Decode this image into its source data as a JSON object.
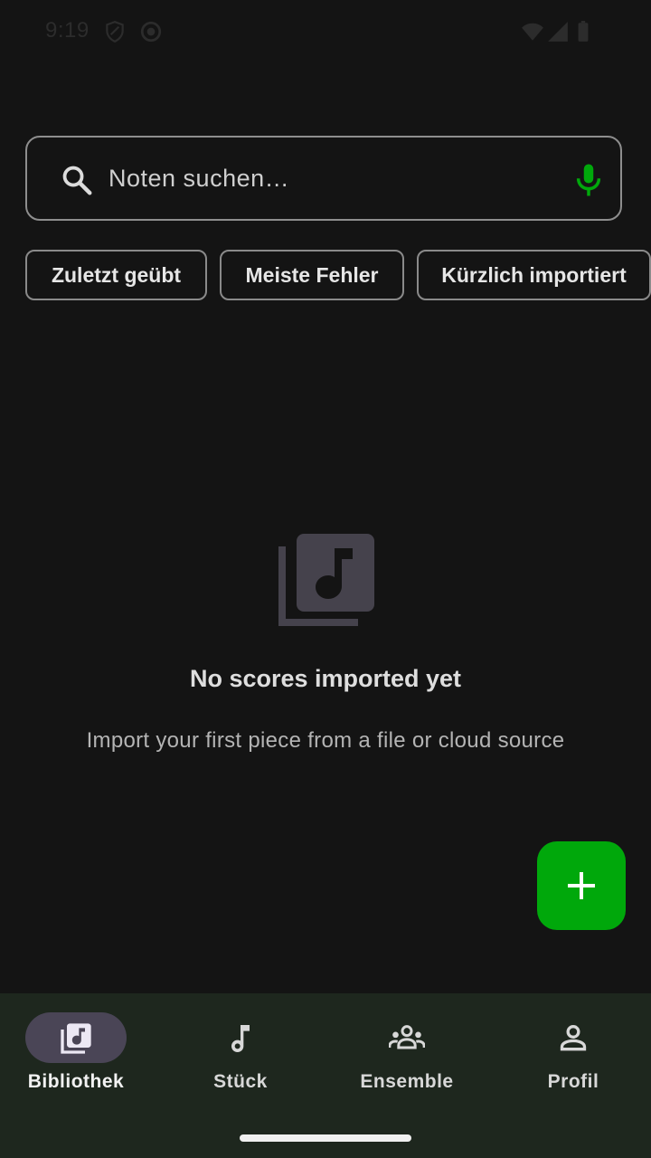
{
  "status_bar": {
    "time": "9:19"
  },
  "search": {
    "placeholder": "Noten suchen…"
  },
  "chips": [
    {
      "label": "Zuletzt geübt"
    },
    {
      "label": "Meiste Fehler"
    },
    {
      "label": "Kürzlich importiert"
    }
  ],
  "empty_state": {
    "title": "No scores imported yet",
    "subtitle": "Import your first piece from a file or cloud source"
  },
  "nav": {
    "items": [
      {
        "label": "Bibliothek",
        "icon": "library-music-icon",
        "active": true
      },
      {
        "label": "Stück",
        "icon": "music-note-icon",
        "active": false
      },
      {
        "label": "Ensemble",
        "icon": "groups-icon",
        "active": false
      },
      {
        "label": "Profil",
        "icon": "person-icon",
        "active": false
      }
    ]
  },
  "colors": {
    "background": "#141414",
    "accent_green": "#00a80b",
    "nav_background": "#1e271e",
    "nav_active_pill": "#4a4556"
  }
}
